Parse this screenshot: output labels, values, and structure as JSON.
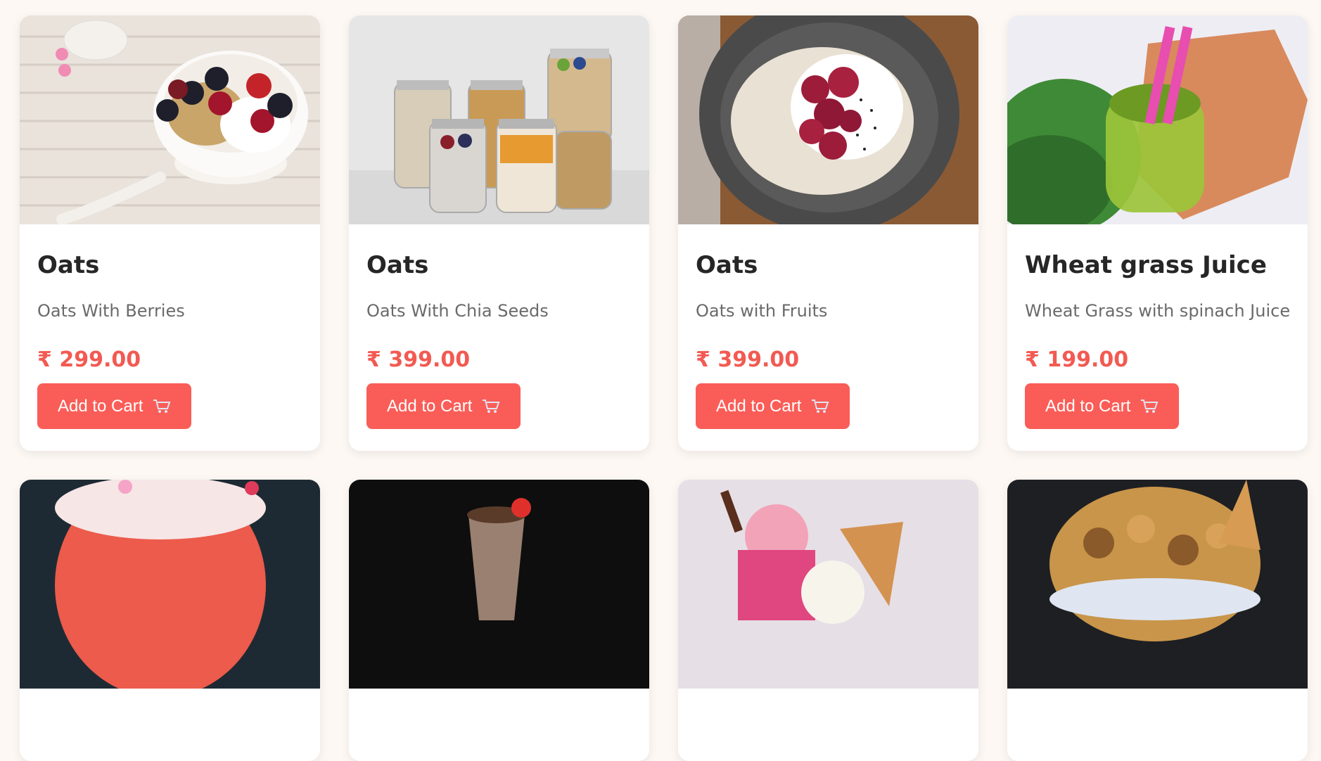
{
  "cart_button_label": "Add to Cart",
  "accent_color": "#fa5d57",
  "price_color": "#f25a52",
  "products": [
    {
      "title": "Oats",
      "description": "Oats With Berries",
      "price": "₹ 299.00",
      "image": "oats-berries-bowl-photo"
    },
    {
      "title": "Oats",
      "description": "Oats With Chia Seeds",
      "price": "₹ 399.00",
      "image": "chia-seed-jars-photo"
    },
    {
      "title": "Oats",
      "description": "Oats with Fruits",
      "price": "₹ 399.00",
      "image": "oats-fruits-bowl-photo"
    },
    {
      "title": "Wheat grass Juice",
      "description": "Wheat Grass with spinach Juice",
      "price": "₹ 199.00",
      "image": "wheatgrass-juice-photo"
    },
    {
      "image": "strawberry-shake-photo"
    },
    {
      "image": "chocolate-milkshake-photo"
    },
    {
      "image": "ice-cream-cones-photo"
    },
    {
      "image": "caramel-popcorn-freakshake-photo"
    }
  ]
}
